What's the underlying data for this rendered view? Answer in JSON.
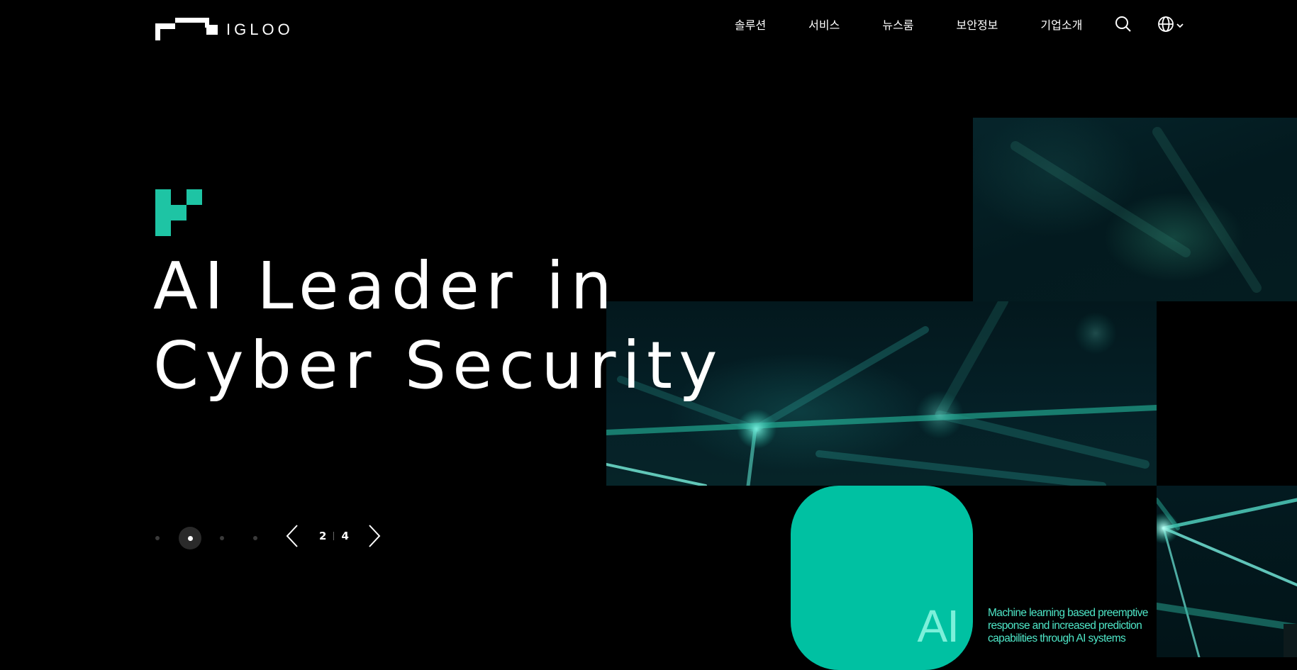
{
  "brand": {
    "name": "IGLOO",
    "accent": "#00c1a2",
    "accent_light": "#4ee6c7"
  },
  "nav": {
    "items": [
      {
        "label": "솔루션"
      },
      {
        "label": "서비스"
      },
      {
        "label": "뉴스룸"
      },
      {
        "label": "보안정보"
      },
      {
        "label": "기업소개"
      }
    ],
    "search_icon": "search-icon",
    "language_icon": "globe-icon"
  },
  "hero": {
    "title_line1": "AI Leader in",
    "title_line2": "Cyber Security"
  },
  "slider": {
    "current": "2",
    "total": "4",
    "dots": 4,
    "active_dot": 2,
    "prev_icon": "chevron-left-icon",
    "next_icon": "chevron-right-icon"
  },
  "feature": {
    "label": "AI",
    "description": "Machine learning based preemptive response and increased prediction capabilities through AI systems"
  }
}
